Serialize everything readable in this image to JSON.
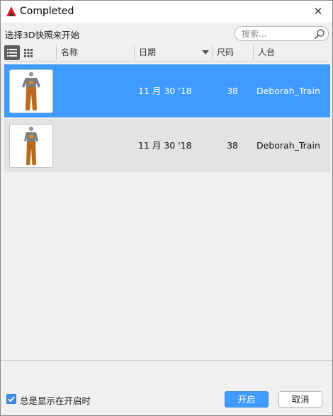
{
  "window": {
    "title": "Completed",
    "close_glyph": "✕"
  },
  "prompt": "选择3D快照来开始",
  "search": {
    "placeholder": "搜索..."
  },
  "columns": {
    "name": "名称",
    "date": "日期",
    "size": "尺码",
    "avatar": "人台"
  },
  "rows": [
    {
      "name": "",
      "date": "11 月 30 '18",
      "size": "38",
      "avatar": "Deborah_Train",
      "selected": true
    },
    {
      "name": "",
      "date": "11 月 30 '18",
      "size": "38",
      "avatar": "Deborah_Train",
      "selected": false
    }
  ],
  "footer": {
    "always_show_label": "总是显示在开启时",
    "always_show_checked": true
  },
  "buttons": {
    "open": "开启",
    "cancel": "取消"
  },
  "colors": {
    "accent": "#3f9bff",
    "row_alt": "#e3e3e3",
    "app_icon": "#d8232a"
  }
}
